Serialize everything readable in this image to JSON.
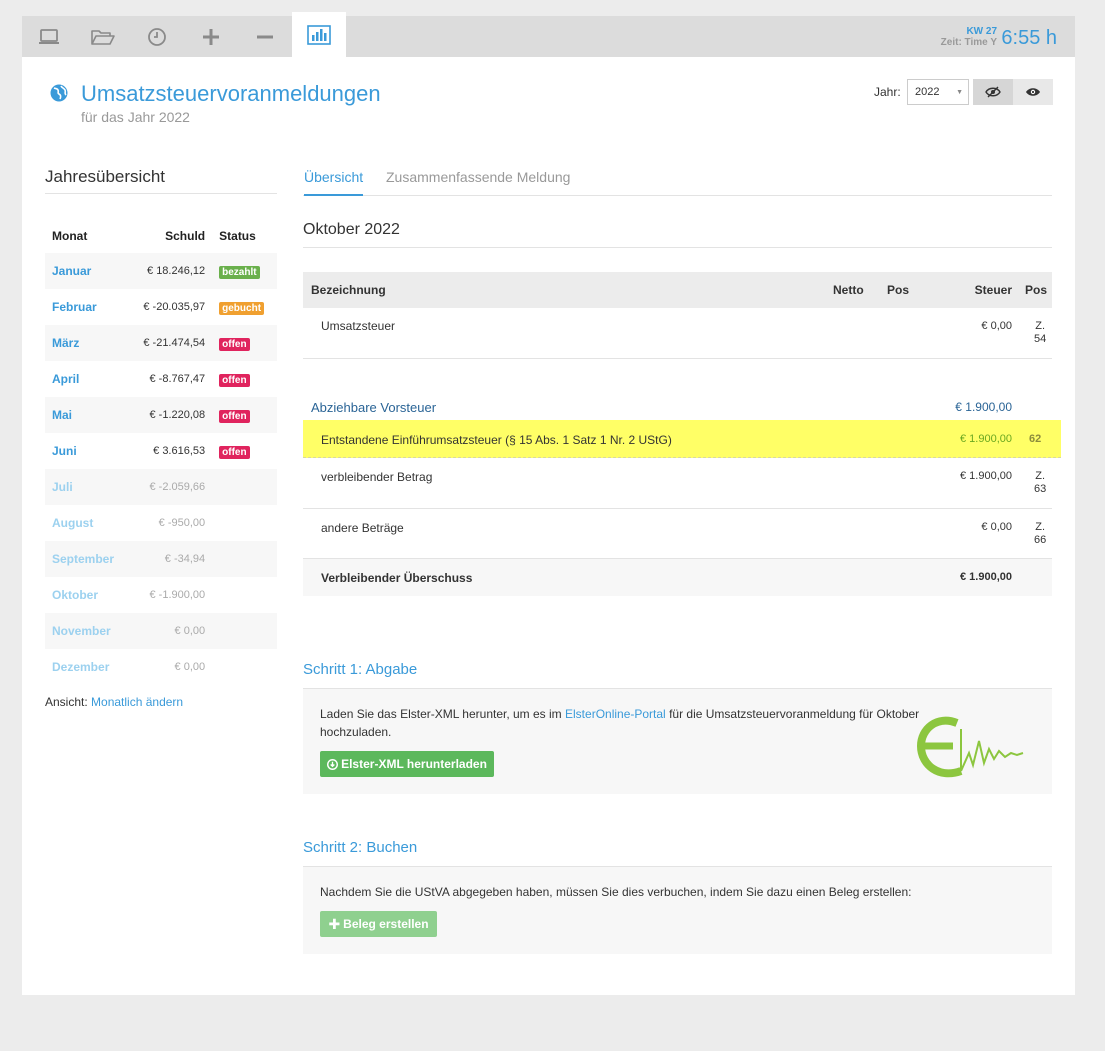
{
  "header": {
    "kw": "KW 27",
    "zeit": "Zeit: Time Y",
    "time": "6:55 h",
    "icons": [
      "laptop-icon",
      "folder-open-icon",
      "clock-icon",
      "plus-icon",
      "minus-icon",
      "bar-chart-icon"
    ]
  },
  "page": {
    "title": "Umsatzsteuervoranmeldungen",
    "subtitle": "für das Jahr 2022",
    "year_label": "Jahr:",
    "year_value": "2022"
  },
  "sidebar": {
    "title": "Jahresübersicht",
    "columns": {
      "month": "Monat",
      "debt": "Schuld",
      "status": "Status"
    },
    "rows": [
      {
        "month": "Januar",
        "amount": "€ 18.246,12",
        "status": "bezahlt",
        "color": "green"
      },
      {
        "month": "Februar",
        "amount": "€ -20.035,97",
        "status": "gebucht",
        "color": "orange"
      },
      {
        "month": "März",
        "amount": "€ -21.474,54",
        "status": "offen",
        "color": "red"
      },
      {
        "month": "April",
        "amount": "€ -8.767,47",
        "status": "offen",
        "color": "red"
      },
      {
        "month": "Mai",
        "amount": "€ -1.220,08",
        "status": "offen",
        "color": "red"
      },
      {
        "month": "Juni",
        "amount": "€ 3.616,53",
        "status": "offen",
        "color": "red"
      },
      {
        "month": "Juli",
        "amount": "€ -2.059,66",
        "status": "",
        "color": ""
      },
      {
        "month": "August",
        "amount": "€ -950,00",
        "status": "",
        "color": ""
      },
      {
        "month": "September",
        "amount": "€ -34,94",
        "status": "",
        "color": ""
      },
      {
        "month": "Oktober",
        "amount": "€ -1.900,00",
        "status": "",
        "color": ""
      },
      {
        "month": "November",
        "amount": "€ 0,00",
        "status": "",
        "color": ""
      },
      {
        "month": "Dezember",
        "amount": "€ 0,00",
        "status": "",
        "color": ""
      }
    ],
    "view_prefix": "Ansicht:",
    "view_link": "Monatlich ändern"
  },
  "tabs": {
    "overview": "Übersicht",
    "summary": "Zusammenfassende Meldung"
  },
  "period": "Oktober 2022",
  "table": {
    "headers": {
      "name": "Bezeichnung",
      "netto": "Netto",
      "pos1": "Pos",
      "steuer": "Steuer",
      "pos2": "Pos"
    },
    "umsatzsteuer": {
      "name": "Umsatzsteuer",
      "steuer": "€ 0,00",
      "pos_a": "Z.",
      "pos_b": "54"
    },
    "vorsteuer_title": "Abziehbare Vorsteuer",
    "vorsteuer_total": "€ 1.900,00",
    "einfuhr": {
      "name": "Entstandene Einführumsatzsteuer (§ 15 Abs. 1 Satz 1 Nr. 2 UStG)",
      "steuer": "€ 1.900,00",
      "pos": "62"
    },
    "verbleibend": {
      "name": "verbleibender Betrag",
      "steuer": "€ 1.900,00",
      "pos_a": "Z.",
      "pos_b": "63"
    },
    "andere": {
      "name": "andere Beträge",
      "steuer": "€ 0,00",
      "pos_a": "Z.",
      "pos_b": "66"
    },
    "ueberschuss": {
      "name": "Verbleibender Überschuss",
      "steuer": "€ 1.900,00"
    }
  },
  "step1": {
    "title": "Schritt 1: Abgabe",
    "text_a": "Laden Sie das Elster-XML herunter, um es im ",
    "link": "ElsterOnline-Portal",
    "text_b": " für die Umsatzsteuervoranmeldung für Oktober",
    "text_c": "hochzuladen.",
    "button": "Elster-XML herunterladen"
  },
  "step2": {
    "title": "Schritt 2: Buchen",
    "text": "Nachdem Sie die UStVA abgegeben haben, müssen Sie dies verbuchen, indem Sie dazu einen Beleg erstellen:",
    "button": "Beleg erstellen"
  },
  "colors": {
    "accent": "#3a9ad9",
    "highlight": "#ffff66",
    "green": "#5cb85c"
  }
}
